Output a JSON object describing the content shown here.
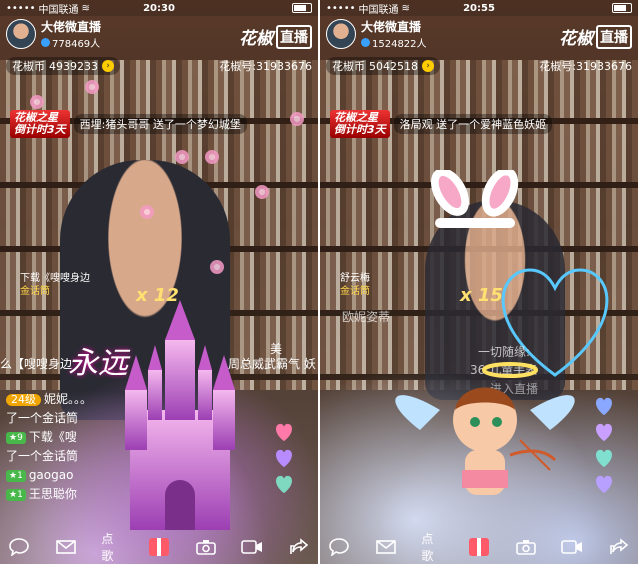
{
  "screens": [
    {
      "status": {
        "carrier": "中国联通",
        "time": "20:30"
      },
      "host": {
        "name": "大佬微直播",
        "fans": "778469人"
      },
      "brand": {
        "name": "花椒",
        "box": "直播"
      },
      "coins": {
        "label": "花椒币",
        "value": "4939233"
      },
      "room": {
        "label": "花椒号:",
        "id": "31933676"
      },
      "banner": {
        "badge_line1": "花椒之星",
        "badge_line2": "倒计时3天",
        "text": "西埋:猪头哥哥 送了一个梦幻城堡"
      },
      "gift_tag": {
        "title": "下载《嗖嗖身边",
        "name": "金话筒"
      },
      "combo": "x 12",
      "center_text": "永远",
      "right_text": "周总威武霸气 妖",
      "left_text": "么【嗖嗖身边",
      "right_top": "美",
      "chat": [
        {
          "level": "24级",
          "text": "妮妮。。。"
        },
        {
          "text": "了一个金话筒"
        },
        {
          "level": "9",
          "text": "下载《嗖"
        },
        {
          "text": "了一个金话筒"
        },
        {
          "level": "1",
          "text": "gaogao"
        },
        {
          "level": "1",
          "text": "王思聪你"
        }
      ],
      "toolbar": {
        "song": "点歌"
      }
    },
    {
      "status": {
        "carrier": "中国联通",
        "time": "20:55"
      },
      "host": {
        "name": "大佬微直播",
        "fans": "1524822人"
      },
      "brand": {
        "name": "花椒",
        "box": "直播"
      },
      "coins": {
        "label": "花椒币",
        "value": "5042518"
      },
      "room": {
        "label": "花椒号:",
        "id": "31933676"
      },
      "banner": {
        "badge_line1": "花椒之星",
        "badge_line2": "倒计时3天",
        "text": "洛局观 送了一个爱神蓝色妖姬"
      },
      "gift_tag": {
        "title": "舒云梅",
        "name": "金话筒"
      },
      "combo": "x 15",
      "chat_faint": [
        "欧妮姿蒂",
        "一切随缘:",
        "36 儿童手表",
        "进入直播"
      ],
      "toolbar": {
        "song": "点歌"
      }
    }
  ],
  "colors": {
    "accent": "#ffcc00",
    "combo": "#ffe070",
    "gift_name": "#ffd84a",
    "level_green": "#49b84a",
    "banner_red": "#e33333"
  },
  "icons": [
    "chat-bubble-icon",
    "mail-icon",
    "gift-icon",
    "camera-icon",
    "video-icon",
    "share-icon"
  ]
}
